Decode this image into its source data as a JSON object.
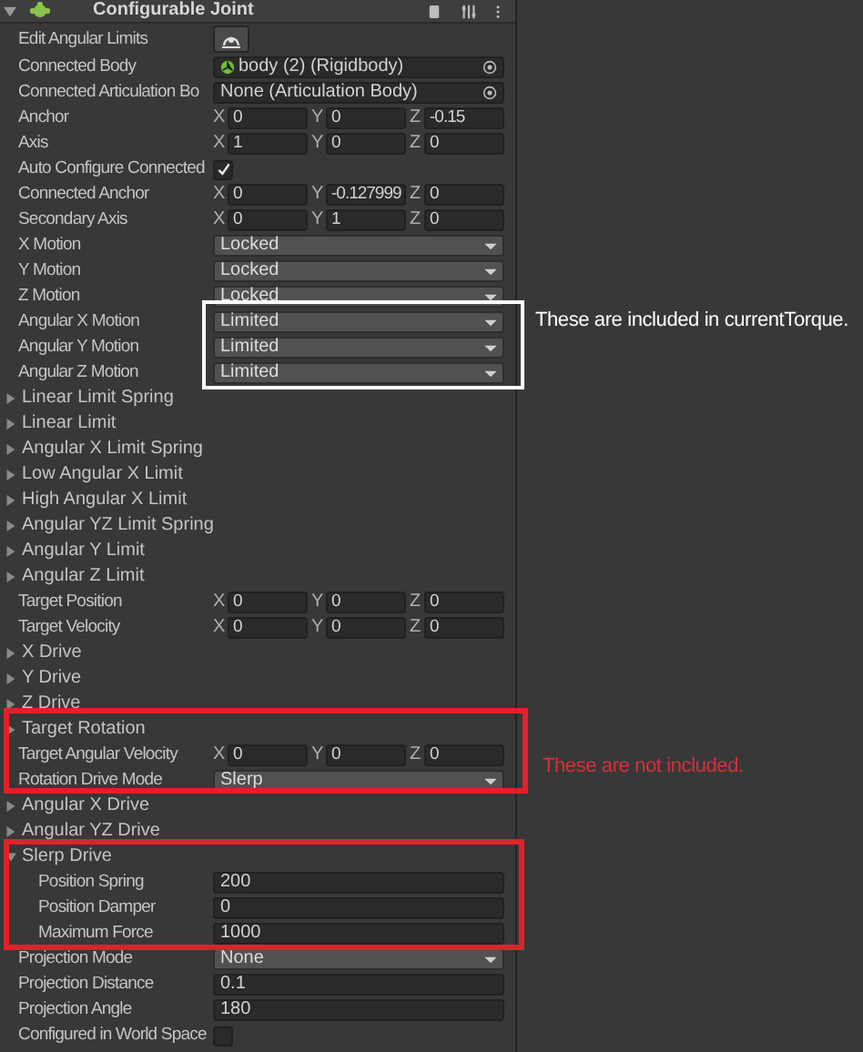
{
  "component": {
    "title": "Configurable Joint",
    "expanded": true
  },
  "rows": [
    {
      "kind": "button",
      "label": "Edit Angular Limits"
    },
    {
      "kind": "object",
      "label": "Connected Body",
      "value": "body (2) (Rigidbody)",
      "has_icon": true
    },
    {
      "kind": "object",
      "label": "Connected Articulation Bo",
      "value": "None (Articulation Body)",
      "has_icon": false
    },
    {
      "kind": "vector3",
      "label": "Anchor",
      "components": [
        {
          "axis": "X",
          "value": "0"
        },
        {
          "axis": "Y",
          "value": "0"
        },
        {
          "axis": "Z",
          "value": "-0.15"
        }
      ]
    },
    {
      "kind": "vector3",
      "label": "Axis",
      "components": [
        {
          "axis": "X",
          "value": "1"
        },
        {
          "axis": "Y",
          "value": "0"
        },
        {
          "axis": "Z",
          "value": "0"
        }
      ]
    },
    {
      "kind": "checkbox",
      "label": "Auto Configure Connected",
      "checked": true
    },
    {
      "kind": "vector3",
      "label": "Connected Anchor",
      "components": [
        {
          "axis": "X",
          "value": "0"
        },
        {
          "axis": "Y",
          "value": "-0.127999"
        },
        {
          "axis": "Z",
          "value": "0"
        }
      ]
    },
    {
      "kind": "vector3",
      "label": "Secondary Axis",
      "components": [
        {
          "axis": "X",
          "value": "0"
        },
        {
          "axis": "Y",
          "value": "1"
        },
        {
          "axis": "Z",
          "value": "0"
        }
      ]
    },
    {
      "kind": "dropdown",
      "label": "X Motion",
      "value": "Locked"
    },
    {
      "kind": "dropdown",
      "label": "Y Motion",
      "value": "Locked"
    },
    {
      "kind": "dropdown",
      "label": "Z Motion",
      "value": "Locked"
    },
    {
      "kind": "dropdown",
      "label": "Angular X Motion",
      "value": "Limited"
    },
    {
      "kind": "dropdown",
      "label": "Angular Y Motion",
      "value": "Limited"
    },
    {
      "kind": "dropdown",
      "label": "Angular Z Motion",
      "value": "Limited"
    },
    {
      "kind": "foldout",
      "label": "Linear Limit Spring",
      "expanded": false
    },
    {
      "kind": "foldout",
      "label": "Linear Limit",
      "expanded": false
    },
    {
      "kind": "foldout",
      "label": "Angular X Limit Spring",
      "expanded": false
    },
    {
      "kind": "foldout",
      "label": "Low Angular X Limit",
      "expanded": false
    },
    {
      "kind": "foldout",
      "label": "High Angular X Limit",
      "expanded": false
    },
    {
      "kind": "foldout",
      "label": "Angular YZ Limit Spring",
      "expanded": false
    },
    {
      "kind": "foldout",
      "label": "Angular Y Limit",
      "expanded": false
    },
    {
      "kind": "foldout",
      "label": "Angular Z Limit",
      "expanded": false
    },
    {
      "kind": "vector3",
      "label": "Target Position",
      "components": [
        {
          "axis": "X",
          "value": "0"
        },
        {
          "axis": "Y",
          "value": "0"
        },
        {
          "axis": "Z",
          "value": "0"
        }
      ]
    },
    {
      "kind": "vector3",
      "label": "Target Velocity",
      "components": [
        {
          "axis": "X",
          "value": "0"
        },
        {
          "axis": "Y",
          "value": "0"
        },
        {
          "axis": "Z",
          "value": "0"
        }
      ]
    },
    {
      "kind": "foldout",
      "label": "X Drive",
      "expanded": false
    },
    {
      "kind": "foldout",
      "label": "Y Drive",
      "expanded": false
    },
    {
      "kind": "foldout",
      "label": "Z Drive",
      "expanded": false
    },
    {
      "kind": "foldout",
      "label": "Target Rotation",
      "expanded": false
    },
    {
      "kind": "vector3",
      "label": "Target Angular Velocity",
      "components": [
        {
          "axis": "X",
          "value": "0"
        },
        {
          "axis": "Y",
          "value": "0"
        },
        {
          "axis": "Z",
          "value": "0"
        }
      ]
    },
    {
      "kind": "dropdown",
      "label": "Rotation Drive Mode",
      "value": "Slerp"
    },
    {
      "kind": "foldout",
      "label": "Angular X Drive",
      "expanded": false
    },
    {
      "kind": "foldout",
      "label": "Angular YZ Drive",
      "expanded": false
    },
    {
      "kind": "foldout",
      "label": "Slerp Drive",
      "expanded": true,
      "children": [
        {
          "kind": "float",
          "label": "Position Spring",
          "value": "200"
        },
        {
          "kind": "float",
          "label": "Position Damper",
          "value": "0"
        },
        {
          "kind": "float",
          "label": "Maximum Force",
          "value": "1000"
        }
      ]
    },
    {
      "kind": "dropdown",
      "label": "Projection Mode",
      "value": "None"
    },
    {
      "kind": "float",
      "label": "Projection Distance",
      "value": "0.1"
    },
    {
      "kind": "float",
      "label": "Projection Angle",
      "value": "180"
    },
    {
      "kind": "checkbox",
      "label": "Configured in World Space",
      "checked": false
    }
  ],
  "annotations": {
    "boxes": [
      {
        "color": "#ffffff"
      },
      {
        "color": "#e3202b"
      },
      {
        "color": "#e3202b"
      }
    ],
    "notes": [
      {
        "text": "These are included in currentTorque.",
        "color": "#ffffff"
      },
      {
        "text": "These are not included.",
        "color": "#d8303a"
      }
    ]
  }
}
